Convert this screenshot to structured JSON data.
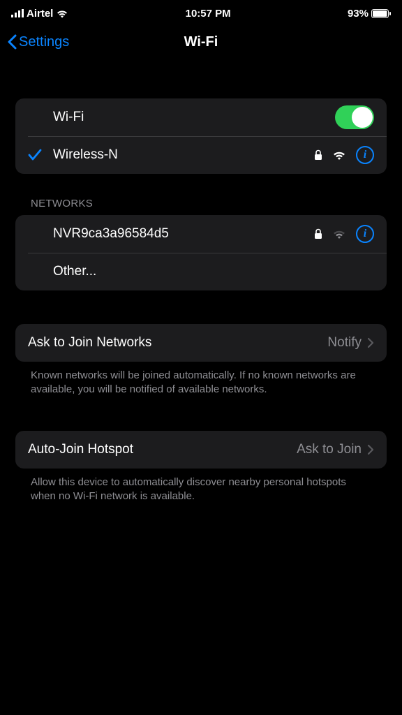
{
  "status_bar": {
    "carrier": "Airtel",
    "time": "10:57 PM",
    "battery_pct": "93%"
  },
  "nav": {
    "back_label": "Settings",
    "title": "Wi-Fi"
  },
  "wifi_section": {
    "toggle_label": "Wi-Fi",
    "toggle_on": true,
    "connected_network": "Wireless-N"
  },
  "networks": {
    "header": "NETWORKS",
    "items": [
      {
        "name": "NVR9ca3a96584d5"
      }
    ],
    "other_label": "Other..."
  },
  "ask_join": {
    "label": "Ask to Join Networks",
    "value": "Notify",
    "footer": "Known networks will be joined automatically. If no known networks are available, you will be notified of available networks."
  },
  "auto_hotspot": {
    "label": "Auto-Join Hotspot",
    "value": "Ask to Join",
    "footer": "Allow this device to automatically discover nearby personal hotspots when no Wi-Fi network is available."
  }
}
